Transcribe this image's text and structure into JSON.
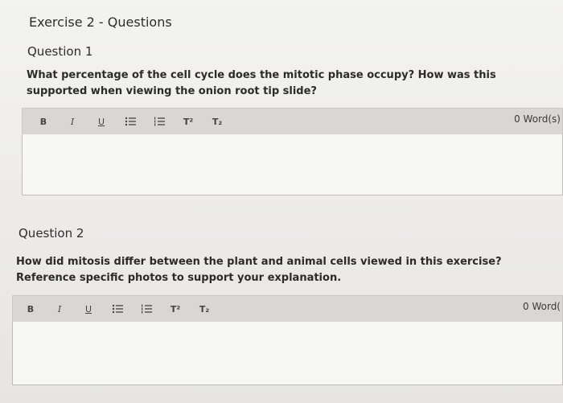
{
  "page": {
    "exercise_title": "Exercise 2 - Questions"
  },
  "question1": {
    "heading": "Question 1",
    "prompt": "What percentage of the cell cycle does the mitotic phase occupy? How was this supported when viewing the onion root tip slide?",
    "word_count": "0 Word(s)",
    "answer": ""
  },
  "question2": {
    "heading": "Question 2",
    "prompt": "How did mitosis differ between the plant and animal cells viewed in this exercise? Reference specific photos to support your explanation.",
    "word_count": "0 Word(",
    "answer": ""
  },
  "toolbar": {
    "bold": "B",
    "italic": "I",
    "underline": "U",
    "superscript": "T²",
    "subscript": "T₂",
    "icons": [
      "bulleted-list-icon",
      "numbered-list-icon"
    ]
  }
}
